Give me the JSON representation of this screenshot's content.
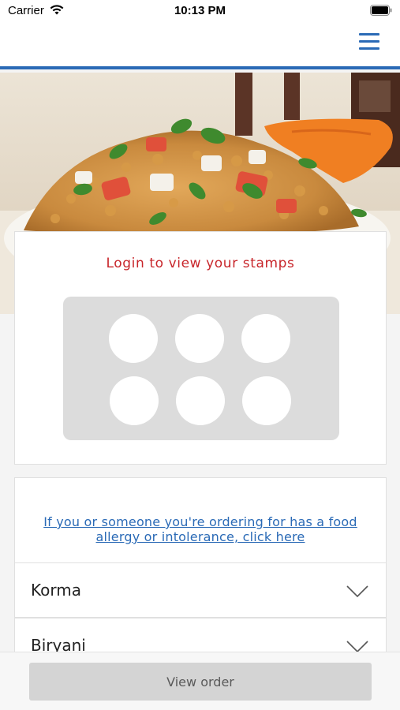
{
  "status_bar": {
    "carrier": "Carrier",
    "time": "10:13 PM"
  },
  "header": {
    "menu_icon": "hamburger-menu-icon",
    "accent_color": "#2a6ab6"
  },
  "hero": {
    "image": "food-photo"
  },
  "stamps": {
    "login_prompt": "Login to view your stamps",
    "slot_count": 6,
    "prompt_color": "#c8262b"
  },
  "allergy": {
    "link_line1": "If you or someone you're ordering for has a food",
    "link_line2": "allergy or intolerance, click here"
  },
  "menu": {
    "categories": [
      {
        "label": "Korma"
      },
      {
        "label": "Biryani"
      }
    ]
  },
  "footer": {
    "view_order_label": "View order"
  }
}
